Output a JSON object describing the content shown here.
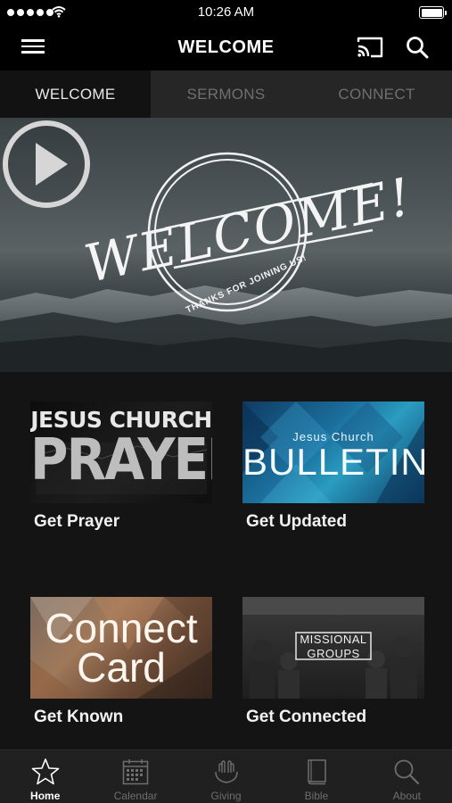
{
  "status_bar": {
    "time": "10:26 AM"
  },
  "nav": {
    "title": "WELCOME"
  },
  "tabs": [
    {
      "label": "WELCOME",
      "active": true
    },
    {
      "label": "SERMONS",
      "active": false
    },
    {
      "label": "CONNECT",
      "active": false
    }
  ],
  "hero": {
    "headline": "WELCOME!",
    "tagline": "THANKS FOR JOINING US!"
  },
  "cards": [
    {
      "label": "Get Prayer",
      "image_line1": "JESUS CHURCH",
      "image_line2": "PRAYER"
    },
    {
      "label": "Get Updated",
      "image_line1": "Jesus Church",
      "image_line2": "BULLETIN"
    },
    {
      "label": "Get Known",
      "image_line1": "Connect",
      "image_line2": "Card"
    },
    {
      "label": "Get Connected",
      "image_line1": "MISSIONAL",
      "image_line2": "GROUPS"
    }
  ],
  "tabbar": [
    {
      "label": "Home",
      "icon": "star-icon",
      "active": true
    },
    {
      "label": "Calendar",
      "icon": "calendar-icon",
      "active": false
    },
    {
      "label": "Giving",
      "icon": "giving-hands-icon",
      "active": false
    },
    {
      "label": "Bible",
      "icon": "bible-book-icon",
      "active": false
    },
    {
      "label": "About",
      "icon": "search-about-icon",
      "active": false
    }
  ]
}
